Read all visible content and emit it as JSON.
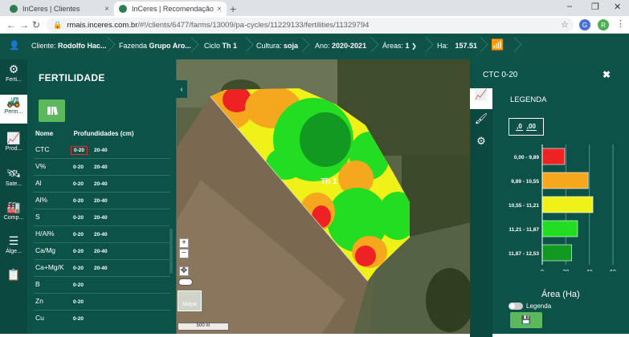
{
  "browser": {
    "tabs": [
      {
        "title": "InCeres | Clientes",
        "close": "×"
      },
      {
        "title": "InCeres | Recomendação",
        "close": "×"
      }
    ],
    "new_tab": "+",
    "window_controls": [
      "–",
      "❐",
      "✕"
    ],
    "url_prefix": "rmais.inceres.com.br",
    "url_path": "/#!/clients/6477/farms/13009/pa-cycles/11229133/fertilities/11329794",
    "avatar_letter": "R"
  },
  "header": {
    "client_label": "Cliente:",
    "client_value": "Rodolfo Hac...",
    "farm_label": "Fazenda",
    "farm_value": "Grupo Aro...",
    "cycle_label": "Ciclo",
    "cycle_value": "Th 1",
    "crop_label": "Cultura:",
    "crop_value": "soja",
    "year_label": "Ano:",
    "year_value": "2020-2021",
    "areas_label": "Áreas:",
    "areas_value": "1",
    "ha_label": "Ha:",
    "ha_value": "157.51"
  },
  "leftnav": [
    {
      "label": "Ferti...",
      "icon": "fertility-icon"
    },
    {
      "label": "Perm...",
      "icon": "tractor-icon"
    },
    {
      "label": "Prod...",
      "icon": "chart-line-icon"
    },
    {
      "label": "Sate...",
      "icon": "satellite-icon"
    },
    {
      "label": "Comp...",
      "icon": "machine-icon"
    },
    {
      "label": "Álge...",
      "icon": "layers-icon"
    },
    {
      "label": "",
      "icon": "document-icon"
    }
  ],
  "fertility": {
    "title": "FERTILIDADE",
    "col_name": "Nome",
    "col_depths": "Profundidades (cm)",
    "rows": [
      {
        "name": "CTC",
        "d1": "0-20",
        "d2": "20-40"
      },
      {
        "name": "V%",
        "d1": "0-20",
        "d2": "20-40"
      },
      {
        "name": "Al",
        "d1": "0-20",
        "d2": "20-40"
      },
      {
        "name": "Al%",
        "d1": "0-20",
        "d2": "20-40"
      },
      {
        "name": "S",
        "d1": "0-20",
        "d2": "20-40"
      },
      {
        "name": "H/Al%",
        "d1": "0-20",
        "d2": "20-40"
      },
      {
        "name": "Ca/Mg",
        "d1": "0-20",
        "d2": "20-40"
      },
      {
        "name": "Ca+Mg/K",
        "d1": "0-20",
        "d2": "20-40"
      },
      {
        "name": "B",
        "d1": "0-20",
        "d2": ""
      },
      {
        "name": "Zn",
        "d1": "0-20",
        "d2": ""
      },
      {
        "name": "Cu",
        "d1": "0-20",
        "d2": ""
      }
    ]
  },
  "map": {
    "area_label": "Th 1",
    "zoom_in": "+",
    "zoom_out": "−",
    "scale_label": "500 m",
    "basemap_label": "Mapa",
    "collapse": "‹"
  },
  "legend_panel": {
    "title": "CTC 0-20",
    "close": "✖",
    "legend_title": "LEGENDA",
    "decimals_a": ",0",
    "decimals_b": ",00",
    "area_title": "Área (Ha)",
    "toggle_label": "Legenda"
  },
  "chart_data": {
    "type": "bar",
    "orientation": "horizontal",
    "categories": [
      "0,00 - 9,89",
      "9,89 - 10,55",
      "10,55 - 11,21",
      "11,21 - 11,87",
      "11,87 - 12,53"
    ],
    "values": [
      19,
      39,
      43,
      30,
      25
    ],
    "colors": [
      "#ee2222",
      "#f5a81d",
      "#f1f11a",
      "#22dd22",
      "#119922"
    ],
    "xlabel": "Área (Ha)",
    "xlim": [
      0,
      60
    ],
    "xticks": [
      "0",
      "20",
      "40",
      "60"
    ]
  },
  "colors": {
    "header": "#0e5248",
    "panel": "#0d5248",
    "accent": "#5cb85c"
  }
}
